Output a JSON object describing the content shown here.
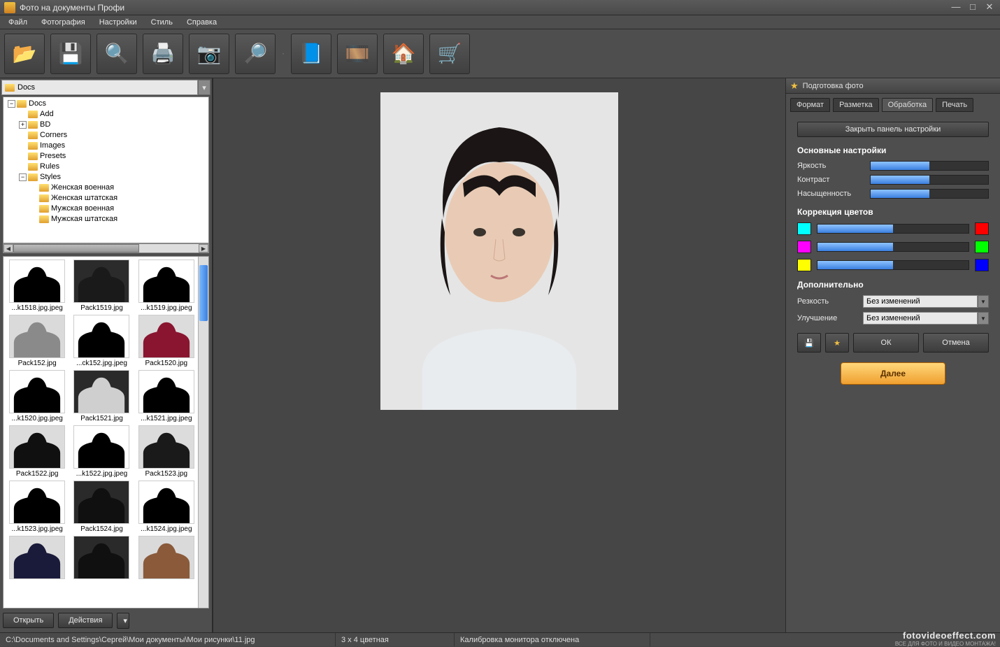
{
  "window": {
    "title": "Фото на документы Профи"
  },
  "menu": {
    "items": [
      "Файл",
      "Фотография",
      "Настройки",
      "Стиль",
      "Справка"
    ]
  },
  "toolbar": {
    "buttons": [
      {
        "name": "open-file",
        "glyph": "📂"
      },
      {
        "name": "save-file",
        "glyph": "💾"
      },
      {
        "name": "zoom-user",
        "glyph": "🔍"
      },
      {
        "name": "print",
        "glyph": "🖨️"
      },
      {
        "name": "camera",
        "glyph": "📷"
      },
      {
        "name": "preview-zoom",
        "glyph": "🔎"
      },
      {
        "name": "help-book",
        "glyph": "📘"
      },
      {
        "name": "media-reel",
        "glyph": "🎞️"
      },
      {
        "name": "home",
        "glyph": "🏠"
      },
      {
        "name": "cart",
        "glyph": "🛒"
      }
    ]
  },
  "sidebar": {
    "path_value": "Docs",
    "tree": {
      "root": "Docs",
      "children": [
        "Add",
        "BD",
        "Corners",
        "Images",
        "Presets",
        "Rules"
      ],
      "styles_node": "Styles",
      "styles_children": [
        "Женская военная",
        "Женская штатская",
        "Мужская военная",
        "Мужская штатская"
      ]
    },
    "thumbnails": [
      {
        "label": "...k1518.jpg.jpeg",
        "bg": "#ffffff",
        "fg": "#000000"
      },
      {
        "label": "Pack1519.jpg",
        "bg": "#2b2b2b",
        "fg": "#1a1a1a"
      },
      {
        "label": "...k1519.jpg.jpeg",
        "bg": "#ffffff",
        "fg": "#000000"
      },
      {
        "label": "Pack152.jpg",
        "bg": "#dadada",
        "fg": "#8a8a8a"
      },
      {
        "label": "...ck152.jpg.jpeg",
        "bg": "#ffffff",
        "fg": "#000000"
      },
      {
        "label": "Pack1520.jpg",
        "bg": "#dcdcdc",
        "fg": "#8a1530"
      },
      {
        "label": "...k1520.jpg.jpeg",
        "bg": "#ffffff",
        "fg": "#000000"
      },
      {
        "label": "Pack1521.jpg",
        "bg": "#2a2a2a",
        "fg": "#cfcfcf"
      },
      {
        "label": "...k1521.jpg.jpeg",
        "bg": "#ffffff",
        "fg": "#000000"
      },
      {
        "label": "Pack1522.jpg",
        "bg": "#dcdcdc",
        "fg": "#101010"
      },
      {
        "label": "...k1522.jpg.jpeg",
        "bg": "#ffffff",
        "fg": "#000000"
      },
      {
        "label": "Pack1523.jpg",
        "bg": "#dcdcdc",
        "fg": "#1a1a1a"
      },
      {
        "label": "...k1523.jpg.jpeg",
        "bg": "#ffffff",
        "fg": "#000000"
      },
      {
        "label": "Pack1524.jpg",
        "bg": "#2a2a2a",
        "fg": "#101010"
      },
      {
        "label": "...k1524.jpg.jpeg",
        "bg": "#ffffff",
        "fg": "#000000"
      },
      {
        "label": "",
        "bg": "#dcdcdc",
        "fg": "#1a1a3a"
      },
      {
        "label": "",
        "bg": "#2a2a2a",
        "fg": "#101010"
      },
      {
        "label": "",
        "bg": "#dadada",
        "fg": "#8a5a3a"
      }
    ],
    "open_label": "Открыть",
    "actions_label": "Действия"
  },
  "right_panel": {
    "header": "Подготовка фото",
    "tabs": [
      "Формат",
      "Разметка",
      "Обработка",
      "Печать"
    ],
    "active_tab": 2,
    "close_panel_label": "Закрыть панель настройки",
    "section_basic": "Основные настройки",
    "sliders": [
      {
        "label": "Яркость",
        "value": 50
      },
      {
        "label": "Контраст",
        "value": 50
      },
      {
        "label": "Насыщенность",
        "value": 50
      }
    ],
    "section_color": "Коррекция цветов",
    "color_rows": [
      {
        "left": "#00ffff",
        "right": "#ff0000",
        "value": 50
      },
      {
        "left": "#ff00ff",
        "right": "#00ff00",
        "value": 50
      },
      {
        "left": "#ffff00",
        "right": "#0000ff",
        "value": 50
      }
    ],
    "section_extra": "Дополнительно",
    "sharpness_label": "Резкость",
    "sharpness_value": "Без изменений",
    "improve_label": "Улучшение",
    "improve_value": "Без изменений",
    "ok_label": "ОК",
    "cancel_label": "Отмена",
    "next_label": "Далее"
  },
  "status": {
    "path": "C:\\Documents and Settings\\Сергей\\Мои документы\\Мои рисунки\\11.jpg",
    "size": "3 x 4 цветная",
    "calib": "Калибровка монитора отключена"
  },
  "watermark": {
    "line1": "fotovideoeffect.com",
    "line2": "ВСЕ ДЛЯ ФОТО И ВИДЕО МОНТАЖА!"
  }
}
